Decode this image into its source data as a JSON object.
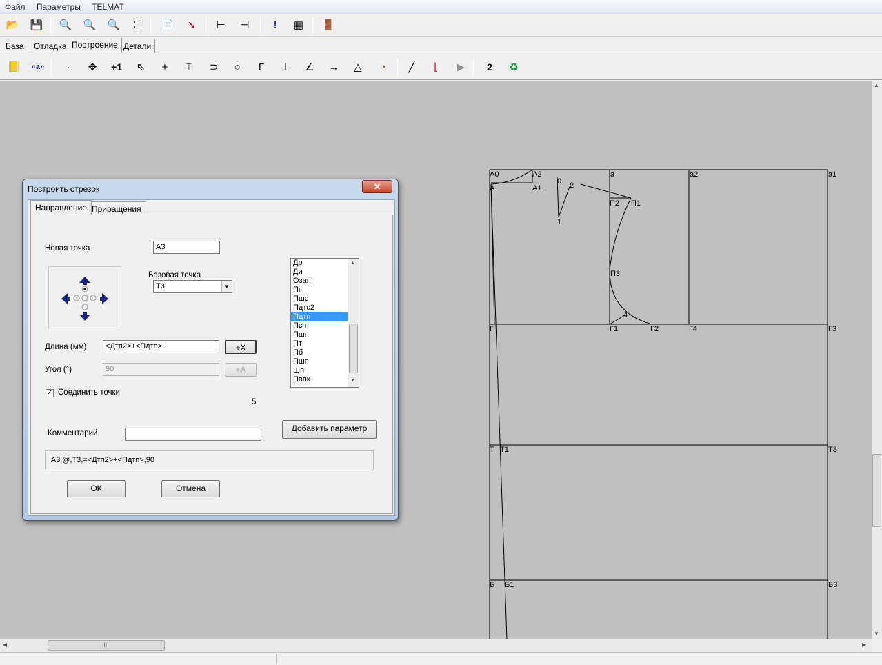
{
  "menu": [
    "Файл",
    "Параметры",
    "TELMAT"
  ],
  "toolbar1": [
    {
      "name": "open-folder-icon",
      "glyph": "📂"
    },
    {
      "name": "save-icon",
      "glyph": "💾"
    },
    {
      "name": "zoom-out-icon",
      "glyph": "🔍"
    },
    {
      "name": "zoom-in-icon",
      "glyph": "🔍"
    },
    {
      "name": "zoom-icon",
      "glyph": "🔍"
    },
    {
      "name": "fit-window-icon",
      "glyph": "⛶"
    },
    {
      "name": "document-icon",
      "glyph": "📄"
    },
    {
      "name": "pointer-red-icon",
      "glyph": "➘"
    },
    {
      "name": "ruler-icon",
      "glyph": "⊢"
    },
    {
      "name": "measure-icon",
      "glyph": "⊣"
    },
    {
      "name": "exclamation-icon",
      "glyph": "!"
    },
    {
      "name": "palette-icon",
      "glyph": "▦"
    },
    {
      "name": "exit-door-icon",
      "glyph": "🚪"
    }
  ],
  "tabs": [
    "База",
    "Отладка",
    "Построение",
    "Детали"
  ],
  "active_tab": "Построение",
  "toolbar2": [
    {
      "name": "notes-icon",
      "glyph": "📒"
    },
    {
      "name": "eye-point-icon",
      "glyph": "«a»"
    },
    {
      "name": "dot-icon",
      "glyph": "·"
    },
    {
      "name": "move-icon",
      "glyph": "✥"
    },
    {
      "name": "plus-one-icon",
      "glyph": "+1"
    },
    {
      "name": "select-icon",
      "glyph": "⇖"
    },
    {
      "name": "cross-icon",
      "glyph": "+"
    },
    {
      "name": "intersect-icon",
      "glyph": "⌶"
    },
    {
      "name": "arc-point-icon",
      "glyph": "⊃"
    },
    {
      "name": "circle-point-icon",
      "glyph": "○"
    },
    {
      "name": "corner-icon",
      "glyph": "Γ"
    },
    {
      "name": "perpendicular-icon",
      "glyph": "⊥"
    },
    {
      "name": "angle-icon",
      "glyph": "∠"
    },
    {
      "name": "arrow-icon",
      "glyph": "→"
    },
    {
      "name": "triangle-icon",
      "glyph": "△"
    },
    {
      "name": "circle-arc-icon",
      "glyph": "◔"
    },
    {
      "name": "line-icon",
      "glyph": "╱"
    },
    {
      "name": "curve-icon",
      "glyph": "⌊"
    },
    {
      "name": "play-icon",
      "glyph": "▶"
    },
    {
      "name": "number-two-icon",
      "glyph": "2"
    },
    {
      "name": "recycle-icon",
      "glyph": "♻"
    }
  ],
  "dialog": {
    "title": "Построить отрезок",
    "close": "✕",
    "tabs": [
      "Направление",
      "Приращения"
    ],
    "new_point_label": "Новая точка",
    "new_point_value": "А3",
    "base_point_label": "Базовая точка",
    "base_point_value": "Т3",
    "length_label": "Длина (мм)",
    "length_value": "<Дтп2>+<Пдтп>",
    "length_btn": "+X",
    "angle_label": "Угол (°)",
    "angle_value": "90",
    "angle_btn": "+A",
    "connect_label": "Соединить точки",
    "connect_checked": true,
    "count": "5",
    "comment_label": "Комментарий",
    "comment_value": "",
    "add_param_btn": "Добавить параметр",
    "formula": "|А3|@,Т3,=<Дтп2>+<Пдтп>,90",
    "ok": "ОК",
    "cancel": "Отмена",
    "params": [
      "Др",
      "Ди",
      "Озап",
      "Пг",
      "Пшс",
      "Пдтс2",
      "Пдтп",
      "Псп",
      "Пшг",
      "Пт",
      "Пб",
      "Пшп",
      "Шп",
      "Пвпк"
    ],
    "selected_param": "Пдтп"
  },
  "drawing_labels": [
    "А0",
    "А",
    "А2",
    "А1",
    "0",
    "2",
    "1",
    "а",
    "П2",
    "П1",
    "а2",
    "а1",
    "П3",
    "4",
    "Г",
    "Г1",
    "Г2",
    "Г4",
    "Г3",
    "Т",
    "Т1",
    "Т3",
    "Б",
    "Б1",
    "Б3"
  ],
  "scroll_grip": "III"
}
